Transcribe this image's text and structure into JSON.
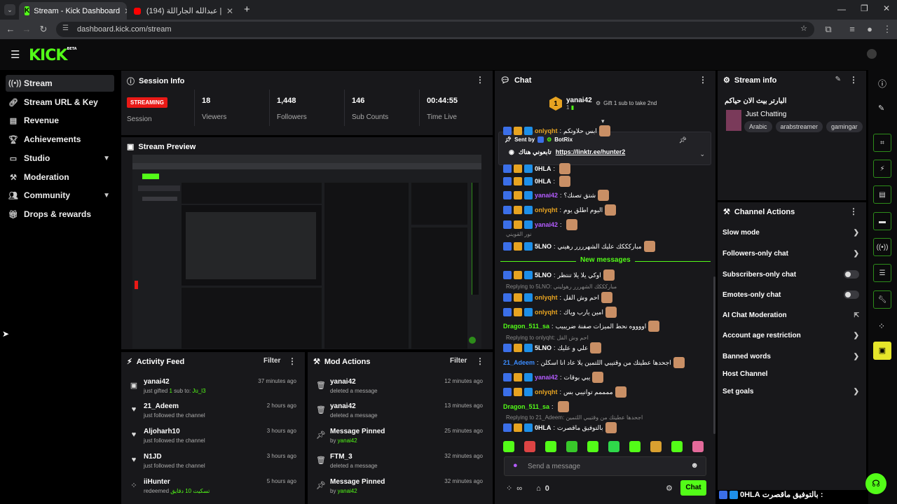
{
  "browser": {
    "tabs": [
      {
        "title": "Stream - Kick Dashboard"
      },
      {
        "title": "(194) ‏قح حث || عبدالله الجاراللة -"
      }
    ],
    "new_tab": "+",
    "url": "dashboard.kick.com/stream"
  },
  "brand": {
    "logo": "KICK",
    "beta": "BETA",
    "accent": "#53fc18"
  },
  "sidebar": {
    "items": [
      {
        "label": "Stream",
        "icon": "broadcast-icon"
      },
      {
        "label": "Stream URL & Key",
        "icon": "link-icon"
      },
      {
        "label": "Revenue",
        "icon": "chart-icon"
      },
      {
        "label": "Achievements",
        "icon": "trophy-icon"
      },
      {
        "label": "Studio",
        "icon": "monitor-icon"
      },
      {
        "label": "Moderation",
        "icon": "hammer-icon"
      },
      {
        "label": "Community",
        "icon": "users-icon"
      },
      {
        "label": "Drops & rewards",
        "icon": "gift-icon"
      }
    ]
  },
  "session": {
    "title": "Session Info",
    "status": "STREAMING",
    "status_label": "Session",
    "stats": [
      {
        "value": "18",
        "label": "Viewers"
      },
      {
        "value": "1,448",
        "label": "Followers"
      },
      {
        "value": "146",
        "label": "Sub Counts"
      },
      {
        "value": "00:44:55",
        "label": "Time Live"
      }
    ]
  },
  "preview": {
    "title": "Stream Preview"
  },
  "activity": {
    "title": "Activity Feed",
    "filter": "Filter",
    "items": [
      {
        "name": "yanai42",
        "desc_pre": "just gifted ",
        "desc_num": "1",
        "desc_mid": " sub to: ",
        "desc_link": "Ju_l3",
        "time": "37 minutes ago",
        "icon": "gift-icon"
      },
      {
        "name": "21_Adeem",
        "desc": "just followed the channel",
        "time": "2 hours ago",
        "icon": "heart-icon"
      },
      {
        "name": "Aljoharh10",
        "desc": "just followed the channel",
        "time": "3 hours ago",
        "icon": "heart-icon"
      },
      {
        "name": "N1JD",
        "desc": "just followed the channel",
        "time": "3 hours ago",
        "icon": "heart-icon"
      },
      {
        "name": "iiHunter",
        "desc": "redeemed",
        "desc_link": "تسكيت 10 دقايق",
        "time": "5 hours ago",
        "icon": "drops-icon"
      }
    ]
  },
  "mod": {
    "title": "Mod Actions",
    "filter": "Filter",
    "items": [
      {
        "name": "yanai42",
        "desc": "deleted a message",
        "time": "12 minutes ago",
        "icon": "trash-icon"
      },
      {
        "name": "yanai42",
        "desc": "deleted a message",
        "time": "13 minutes ago",
        "icon": "trash-icon"
      },
      {
        "name": "Message Pinned",
        "by": "by ",
        "user": "yanai42",
        "time": "25 minutes ago",
        "icon": "pin-icon"
      },
      {
        "name": "FTM_3",
        "desc": "deleted a message",
        "time": "32 minutes ago",
        "icon": "trash-icon"
      },
      {
        "name": "Message Pinned",
        "by": "by ",
        "user": "yanai42",
        "time": "32 minutes ago",
        "icon": "pin-icon"
      }
    ]
  },
  "chat": {
    "title": "Chat",
    "gifter": {
      "rank": "1",
      "name": "yanai42",
      "count": "1",
      "gift_text": "Gift 1 sub to take 2nd"
    },
    "pinned": {
      "sent_by": "Sent by",
      "bot": "BotRix",
      "msg": "تابعوني هناك",
      "link": "https://linktr.ee/hunter2"
    },
    "new_messages": "New messages",
    "input_placeholder": "Send a message",
    "chat_button": "Chat",
    "points": "0",
    "infinity": "∞",
    "messages": [
      {
        "user": "onlyqht",
        "text": "ابس حلاوتكم",
        "color": "#e7a321",
        "reply": ""
      },
      {
        "user": "0HLA",
        "text": "",
        "color": "#ffffff",
        "reply": ""
      },
      {
        "user": "0HLA",
        "text": "",
        "color": "#ffffff",
        "reply": ""
      },
      {
        "user": "yanai42",
        "text": "شتق تصنك؟",
        "color": "#b45cff",
        "reply": ""
      },
      {
        "user": "onlyqht",
        "text": "اليوم اطلق يوم",
        "color": "#e7a321",
        "reply": ""
      },
      {
        "user": "yanai42",
        "text": "",
        "color": "#b45cff",
        "reply": ""
      },
      {
        "user": "5LNO",
        "text": "مباركككك عليك الشهرررر رهيني",
        "color": "#ffffff",
        "reply": "نور القويني"
      },
      {
        "user": "5LNO",
        "text": "اوكي يلا يلا تنتظر",
        "color": "#ffffff",
        "reply": ""
      },
      {
        "user": "onlyqht",
        "text": "احم وش القل",
        "color": "#e7a321",
        "reply": "Replying to 5LNO: مباركككك الشهررر رهوليني"
      },
      {
        "user": "onlyqht",
        "text": "امين يارب وياك",
        "color": "#e7a321",
        "reply": ""
      },
      {
        "user": "Dragon_511_sa",
        "text": "اووووه نحط الميزات صفنة ضريبيب",
        "color": "#53fc18",
        "reply": ""
      },
      {
        "user": "5LNO",
        "text": "علي و عليك",
        "color": "#ffffff",
        "reply": "Replying to onlyqht: احم وش القل"
      },
      {
        "user": "21_Adeem",
        "text": "اجحدها عطيتك من وقتيبي اللتمين يلا عاد انا اسكلن",
        "color": "#3b8cff",
        "reply": ""
      },
      {
        "user": "yanai42",
        "text": "يبي بوقات",
        "color": "#b45cff",
        "reply": ""
      },
      {
        "user": "onlyqht",
        "text": "ممممم توانيبي بس",
        "color": "#e7a321",
        "reply": ""
      },
      {
        "user": "Dragon_511_sa",
        "text": "",
        "color": "#53fc18",
        "reply": ""
      },
      {
        "user": "0HLA",
        "text": "بالتوفيق ماقصرت",
        "color": "#ffffff",
        "reply": "Replying to 21_Adeem: اجحدها عطيتك من وقتيبي اللتمين"
      }
    ]
  },
  "stream_info": {
    "title": "Stream info",
    "stream_title": "البارتر بيث الان حياكم",
    "category": "Just Chatting",
    "tags": [
      "Arabic",
      "arabstreamer",
      "gamingar"
    ]
  },
  "channel_actions": {
    "title": "Channel Actions",
    "items": [
      {
        "label": "Slow mode",
        "control": "chevron"
      },
      {
        "label": "Followers-only chat",
        "control": "chevron"
      },
      {
        "label": "Subscribers-only chat",
        "control": "toggle"
      },
      {
        "label": "Emotes-only chat",
        "control": "toggle"
      },
      {
        "label": "AI Chat Moderation",
        "control": "external"
      },
      {
        "label": "Account age restriction",
        "control": "chevron"
      },
      {
        "label": "Banned words",
        "control": "chevron"
      },
      {
        "label": "Host Channel",
        "control": "none"
      },
      {
        "label": "Set goals",
        "control": "chevron"
      }
    ]
  },
  "footer_message": {
    "user": "0HLA",
    "text": "بالتوفيق ماقصرت :"
  }
}
